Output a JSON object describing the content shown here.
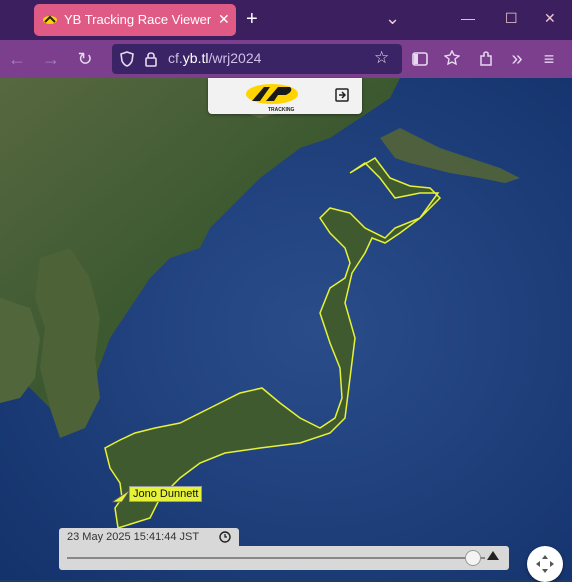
{
  "browser": {
    "tab_title": "YB Tracking Race Viewer - Wind",
    "tab_close": "✕",
    "new_tab": "+",
    "tab_list": "⌄",
    "minimize": "—",
    "maximize": "☐",
    "close": "✕",
    "url_domain_prefix": "cf.",
    "url_domain": "yb.tl",
    "url_path": "/wrj2024"
  },
  "toolbar_icons": [
    "back-arrow-icon",
    "forward-arrow-icon",
    "reload-icon",
    "shield-icon",
    "lock-icon",
    "star-icon",
    "sidebar-icon",
    "pocket-icon",
    "extensions-icon",
    "overflow-icon",
    "menu-icon"
  ],
  "logo": {
    "brand": "TRACKING"
  },
  "boat": {
    "name": "Jono Dunnett"
  },
  "timeline": {
    "timestamp": "23 May 2025 15:41:44 JST",
    "progress": 0.97
  },
  "colors": {
    "accent": "#e6f238",
    "tab": "#e05a86",
    "titlebar": "#3b1f5e",
    "navbar": "#7b3f8e"
  }
}
